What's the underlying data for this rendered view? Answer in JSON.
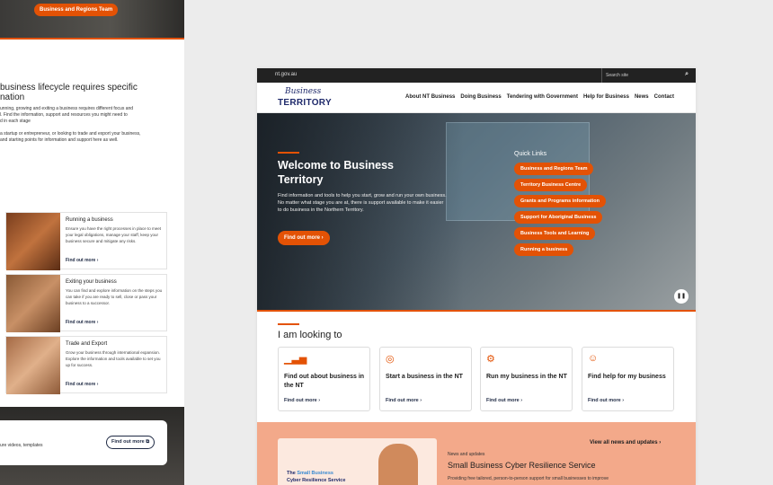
{
  "left_page": {
    "top_button": "Business and Regions Team",
    "heading": "business lifecycle requires specific\nnation",
    "para1": "unning, growing and exiting a business requires different focus and\nl. Find the information, support and resources you might need to\nd in each stage",
    "para2": "a startup or entrepreneur, or looking to trade and export your business,\nand starting points for information and support here as well.",
    "cards": [
      {
        "title": "Running a business",
        "desc": "Ensure you have the right processes in place to meet your legal obligations, manage your staff, keep your business secure and mitigate any risks.",
        "link": "Find out more ›"
      },
      {
        "title": "Exiting your business",
        "desc": "You can find and explore information on the steps you can take if you are ready to sell, close or pass your business to a successor.",
        "link": "Find out more ›"
      },
      {
        "title": "Trade and Export",
        "desc": "Grow your business through international expansion. Explore the information and tools available to set you up for success.",
        "link": "Find out more ›"
      }
    ],
    "bottom_text": "ure videos, templates",
    "bottom_button": "Find out more ⧉"
  },
  "gov_bar": {
    "site": "nt.gov.au",
    "search_placeholder": "Search site"
  },
  "logo": {
    "script": "Business",
    "word": "TERRITORY"
  },
  "nav": [
    "About NT Business",
    "Doing Business",
    "Tendering with Government",
    "Help for Business",
    "News",
    "Contact"
  ],
  "hero": {
    "title": "Welcome to Business Territory",
    "text": "Find information and tools to help you start, grow and run your own business. No matter what stage you are at, there is support available to make it easier to do business in the Northern Territory.",
    "button": "Find out more ›",
    "quick_links_title": "Quick Links",
    "quick_links": [
      "Business and Regions Team",
      "Territory Business Centre",
      "Grants and Programs information",
      "Support for Aboriginal Business",
      "Business Tools and Learning",
      "Running a business"
    ]
  },
  "looking": {
    "title": "I am looking to",
    "cards": [
      {
        "icon": "bar-chart-icon",
        "title": "Find out about business in the NT",
        "link": "Find out more ›"
      },
      {
        "icon": "target-icon",
        "title": "Start a business in the NT",
        "link": "Find out more ›"
      },
      {
        "icon": "gear-icon",
        "title": "Run my business in the NT",
        "link": "Find out more ›"
      },
      {
        "icon": "help-icon",
        "title": "Find help for my business",
        "link": "Find out more ›"
      }
    ]
  },
  "news": {
    "view_all": "View all news and updates ›",
    "label": "News and updates",
    "title": "Small Business Cyber Resilience Service",
    "desc": "Providing free tailored, person-to-person support for small businesses to improve",
    "image_text_1": "The ",
    "image_text_2": "Small Business",
    "image_text_3": "Cyber Resilience Service"
  },
  "colors": {
    "accent": "#e35205",
    "navy": "#1f2a6b"
  }
}
